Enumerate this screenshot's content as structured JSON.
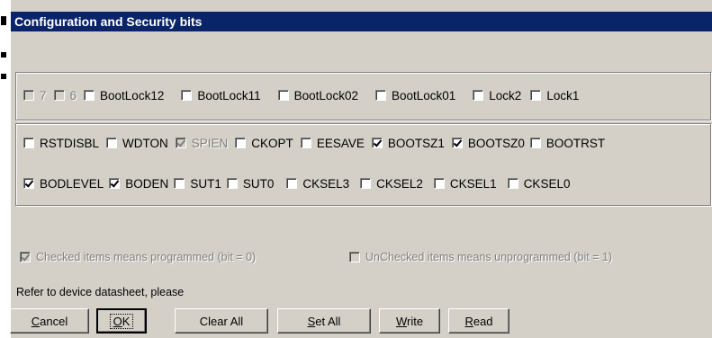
{
  "title": "Configuration and Security bits",
  "lock_bits": [
    {
      "label": "7",
      "checked": false,
      "disabled": true
    },
    {
      "label": "6",
      "checked": false,
      "disabled": true
    },
    {
      "label": "BootLock12",
      "checked": false,
      "disabled": false
    },
    {
      "label": "BootLock11",
      "checked": false,
      "disabled": false
    },
    {
      "label": "BootLock02",
      "checked": false,
      "disabled": false
    },
    {
      "label": "BootLock01",
      "checked": false,
      "disabled": false
    },
    {
      "label": "Lock2",
      "checked": false,
      "disabled": false
    },
    {
      "label": "Lock1",
      "checked": false,
      "disabled": false
    }
  ],
  "fuse_high": [
    {
      "label": "RSTDISBL",
      "checked": false,
      "disabled": false
    },
    {
      "label": "WDTON",
      "checked": false,
      "disabled": false
    },
    {
      "label": "SPIEN",
      "checked": true,
      "disabled": true
    },
    {
      "label": "CKOPT",
      "checked": false,
      "disabled": false
    },
    {
      "label": "EESAVE",
      "checked": false,
      "disabled": false
    },
    {
      "label": "BOOTSZ1",
      "checked": true,
      "disabled": false
    },
    {
      "label": "BOOTSZ0",
      "checked": true,
      "disabled": false
    },
    {
      "label": "BOOTRST",
      "checked": false,
      "disabled": false
    }
  ],
  "fuse_low": [
    {
      "label": "BODLEVEL",
      "checked": true,
      "disabled": false
    },
    {
      "label": "BODEN",
      "checked": true,
      "disabled": false
    },
    {
      "label": "SUT1",
      "checked": false,
      "disabled": false
    },
    {
      "label": "SUT0",
      "checked": false,
      "disabled": false
    },
    {
      "label": "CKSEL3",
      "checked": false,
      "disabled": false
    },
    {
      "label": "CKSEL2",
      "checked": false,
      "disabled": false
    },
    {
      "label": "CKSEL1",
      "checked": false,
      "disabled": false
    },
    {
      "label": "CKSEL0",
      "checked": false,
      "disabled": false
    }
  ],
  "legend": {
    "checked_note": "Checked items means programmed (bit = 0)",
    "unchecked_note": "UnChecked items means unprogrammed (bit = 1)"
  },
  "refer_text": "Refer to device datasheet, please",
  "buttons": {
    "cancel": {
      "underline": "C",
      "rest": "ancel"
    },
    "ok": {
      "underline": "O",
      "rest": "K"
    },
    "clear_all": "Clear All",
    "set_all": {
      "underline": "S",
      "rest": "et All"
    },
    "write": {
      "underline": "W",
      "rest": "rite"
    },
    "read": {
      "underline": "R",
      "rest": "ead"
    }
  }
}
